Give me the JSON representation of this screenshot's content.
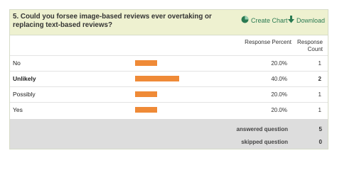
{
  "question": {
    "text": "5. Could you forsee image-based reviews ever overtaking or replacing text-based reviews?"
  },
  "actions": {
    "create_chart": {
      "label": "Create Chart",
      "icon": "pie-chart-icon"
    },
    "download": {
      "label": "Download",
      "icon": "download-arrow-icon"
    }
  },
  "columns": {
    "response_percent": "Response Percent",
    "response_count": "Response Count"
  },
  "rows": [
    {
      "label": "No",
      "percent": "20.0%",
      "count": "1",
      "fraction": 0.2,
      "bold": false
    },
    {
      "label": "Unlikely",
      "percent": "40.0%",
      "count": "2",
      "fraction": 0.4,
      "bold": true
    },
    {
      "label": "Possibly",
      "percent": "20.0%",
      "count": "1",
      "fraction": 0.2,
      "bold": false
    },
    {
      "label": "Yes",
      "percent": "20.0%",
      "count": "1",
      "fraction": 0.2,
      "bold": false
    }
  ],
  "summary": {
    "answered_label": "answered question",
    "answered_value": "5",
    "skipped_label": "skipped question",
    "skipped_value": "0"
  },
  "colors": {
    "bar": "#ef8a37",
    "header_bg": "#eef1d0",
    "action_text": "#2a7a52",
    "footer_bg": "#dddddd"
  }
}
